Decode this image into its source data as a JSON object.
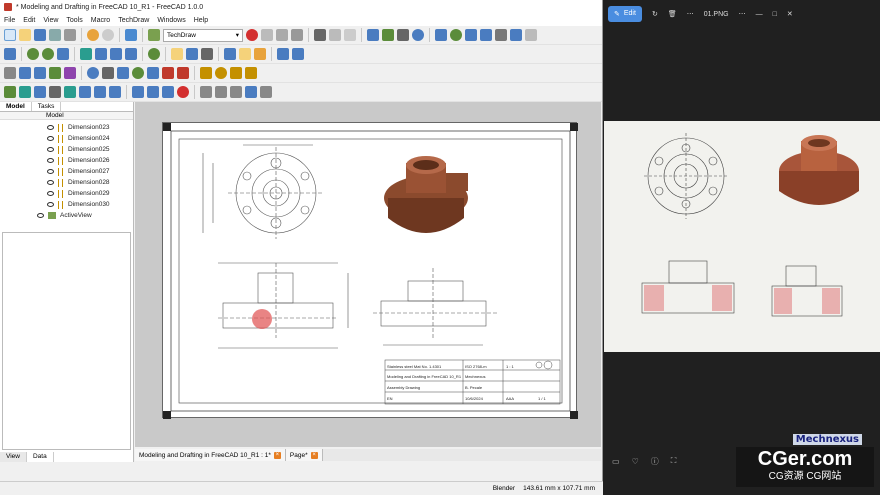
{
  "freecad": {
    "window_title": "* Modeling and Drafting in FreeCAD 10_R1 - FreeCAD 1.0.0",
    "menu": [
      "File",
      "Edit",
      "View",
      "Tools",
      "Macro",
      "TechDraw",
      "Windows",
      "Help"
    ],
    "workbench": "TechDraw",
    "panel_tabs": {
      "model": "Model",
      "tasks": "Tasks"
    },
    "tree_header": "Model",
    "tree_items": [
      "Dimension023",
      "Dimension024",
      "Dimension025",
      "Dimension026",
      "Dimension027",
      "Dimension028",
      "Dimension029",
      "Dimension030"
    ],
    "active_view": "ActiveView",
    "bottom_tabs": {
      "view": "View",
      "data": "Data"
    },
    "doc_tabs": [
      {
        "label": "Modeling and Drafting in FreeCAD 10_R1 : 1*"
      },
      {
        "label": "Page*"
      }
    ],
    "status": {
      "nav": "Blender",
      "dims": "143.61 mm x 107.71 mm"
    },
    "title_block": {
      "material": "Stainless steel Mat No. 1.4301",
      "tolerance": "ISO 2768-m",
      "scale": "1 : 1",
      "title": "Modeling and Drafting in FreeCAD 10_R1",
      "author": "Mechnexus",
      "document_type": "Assembly Drawing",
      "approved": "B. Pecale",
      "language": "EN",
      "date": "10/6/2024",
      "rev": "AAA",
      "sheet": "1 / 1"
    }
  },
  "viewer": {
    "edit_label": "Edit",
    "file_name": "01.PNG"
  },
  "watermarks": {
    "mechnexus": "Mechnexus",
    "cger": "CGer.com",
    "cger_sub": "CG资源 CG网站"
  }
}
